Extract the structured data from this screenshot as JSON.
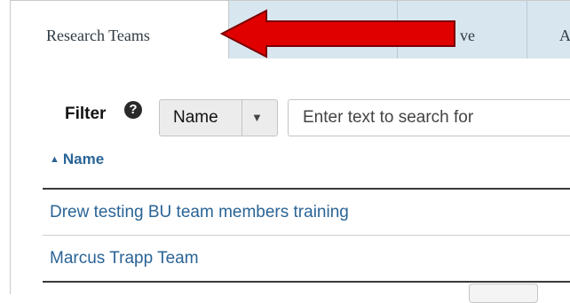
{
  "tabs": [
    {
      "label": "Research Teams"
    },
    {
      "label": ""
    },
    {
      "label": "ve"
    },
    {
      "label": "Ar"
    }
  ],
  "filter": {
    "label": "Filter",
    "help_glyph": "?",
    "select_value": "Name",
    "search_placeholder": "Enter text to search for"
  },
  "table": {
    "column_header": "Name",
    "sort": "ascending",
    "rows": [
      {
        "name": "Drew testing BU team members training"
      },
      {
        "name": "Marcus Trapp Team"
      }
    ]
  },
  "colors": {
    "link": "#2a6496",
    "tab_inactive": "#d8e6ef",
    "arrow": "#e00000"
  },
  "icons": {
    "help": "help-icon",
    "caret": "caret-down-icon",
    "sort": "sort-ascending-icon",
    "arrow": "annotation-arrow"
  }
}
